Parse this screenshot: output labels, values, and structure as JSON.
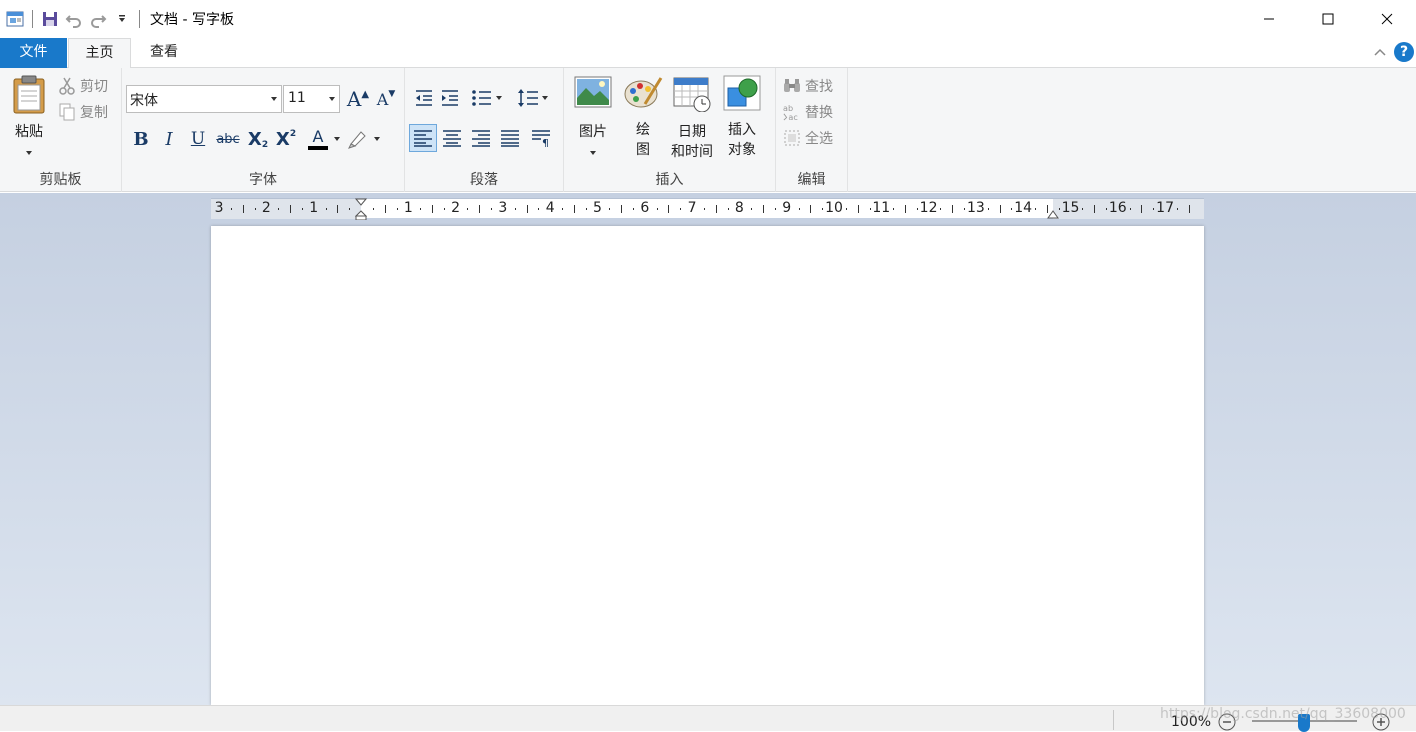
{
  "window": {
    "title": "文档 - 写字板"
  },
  "tabs": {
    "file": "文件",
    "home": "主页",
    "view": "查看"
  },
  "help_label": "?",
  "clipboard": {
    "paste": "粘贴",
    "cut": "剪切",
    "copy": "复制",
    "group_label": "剪贴板"
  },
  "font": {
    "family": "宋体",
    "size": "11",
    "grow_label": "A",
    "shrink_label": "A",
    "bold": "B",
    "italic": "I",
    "underline": "U",
    "strike": "abc",
    "subscript": "X",
    "superscript": "X",
    "color_label": "A",
    "text_color": "#000000",
    "group_label": "字体"
  },
  "paragraph": {
    "group_label": "段落"
  },
  "insert": {
    "picture": "图片",
    "paint_line1": "绘",
    "paint_line2": "图",
    "datetime_line1": "日期",
    "datetime_line2": "和时间",
    "object_line1": "插入",
    "object_line2": "对象",
    "group_label": "插入"
  },
  "editing": {
    "find": "查找",
    "replace": "替换",
    "select_all": "全选",
    "group_label": "编辑"
  },
  "ruler": {
    "labels": [
      "3",
      "2",
      "1",
      "1",
      "2",
      "3",
      "4",
      "5",
      "6",
      "7",
      "8",
      "9",
      "10",
      "11",
      "12",
      "13",
      "14",
      "15",
      "16",
      "17"
    ]
  },
  "status": {
    "zoom": "100%",
    "watermark": "https://blog.csdn.net/qq_33608000"
  },
  "colors": {
    "accent": "#1979ca",
    "ribbon_bg": "#f5f6f7",
    "workspace_bg": "#c5d0e1"
  }
}
